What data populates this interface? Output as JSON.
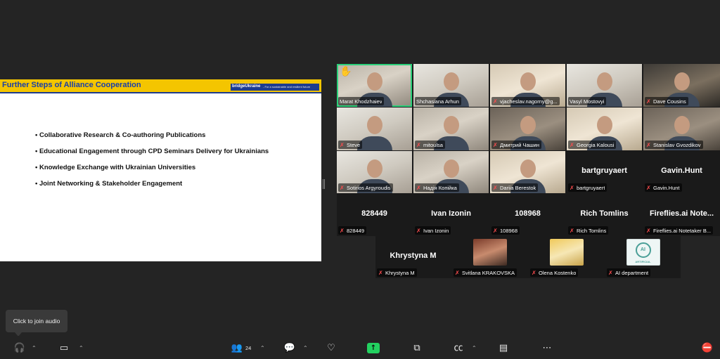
{
  "slide": {
    "title": "Further Steps of Alliance Cooperation",
    "logo": "bridgeUkraine",
    "tagline": "- For a sustainable and resilient future",
    "bullets": [
      "• Collaborative Research & Co-authoring Publications",
      "• Educational Engagement through CPD Seminars Delivery for Ukrainians",
      "• Knowledge Exchange with Ukrainian Universities",
      "• Joint Networking & Stakeholder Engagement"
    ]
  },
  "participants": [
    {
      "name": "Marat Khodzhaiev",
      "hand": "✋"
    },
    {
      "name": "Shchasiana Arhun"
    },
    {
      "name": "vjacheslav.nagorny@g..."
    },
    {
      "name": "Vasyl Mostovyi"
    },
    {
      "name": "Dave Cousins"
    },
    {
      "name": "Steve"
    },
    {
      "name": "mitoulsa"
    },
    {
      "name": "Дмитрий Чашин"
    },
    {
      "name": "Georgia Kalousi"
    },
    {
      "name": "Stanislav Gvozdikov"
    },
    {
      "name": "Sotirios Argyroudis"
    },
    {
      "name": "Надія Копійка"
    },
    {
      "name": "Dariia Berestok"
    },
    {
      "name": "bartgruyaert",
      "display": "bartgruyaert"
    },
    {
      "name": "Gavin.Hunt",
      "display": "Gavin.Hunt"
    },
    {
      "name": "828449",
      "display": "828449"
    },
    {
      "name": "Ivan Izonin",
      "display": "Ivan Izonin"
    },
    {
      "name": "108968",
      "display": "108968"
    },
    {
      "name": "Rich Tomlins",
      "display": "Rich Tomlins"
    },
    {
      "name": "Fireflies.ai Notetaker B...",
      "display": "Fireflies.ai Note..."
    },
    {
      "name": "Khrystyna M",
      "display": "Khrystyna M"
    },
    {
      "name": "Svitlana KRAKOVSKA"
    },
    {
      "name": "Olena Kostenko"
    },
    {
      "name": "AI department",
      "avatar_text": "AI",
      "avatar_caption": "ARTIFICIAL"
    }
  ],
  "mic_muted_icon": "✗",
  "tooltip": "Click to join audio",
  "toolbar": {
    "participants_count": "24",
    "icons": [
      "headphones-icon",
      "video-icon",
      "participants-icon",
      "chat-icon",
      "reactions-icon",
      "share-screen-icon",
      "apps-icon",
      "captions-icon",
      "notes-icon",
      "more-icon",
      "leave-icon"
    ]
  },
  "colors": {
    "accent": "#23d160",
    "muted": "#ff4d4f",
    "slide_header": "#f4c500",
    "slide_title": "#1a3ea8"
  }
}
